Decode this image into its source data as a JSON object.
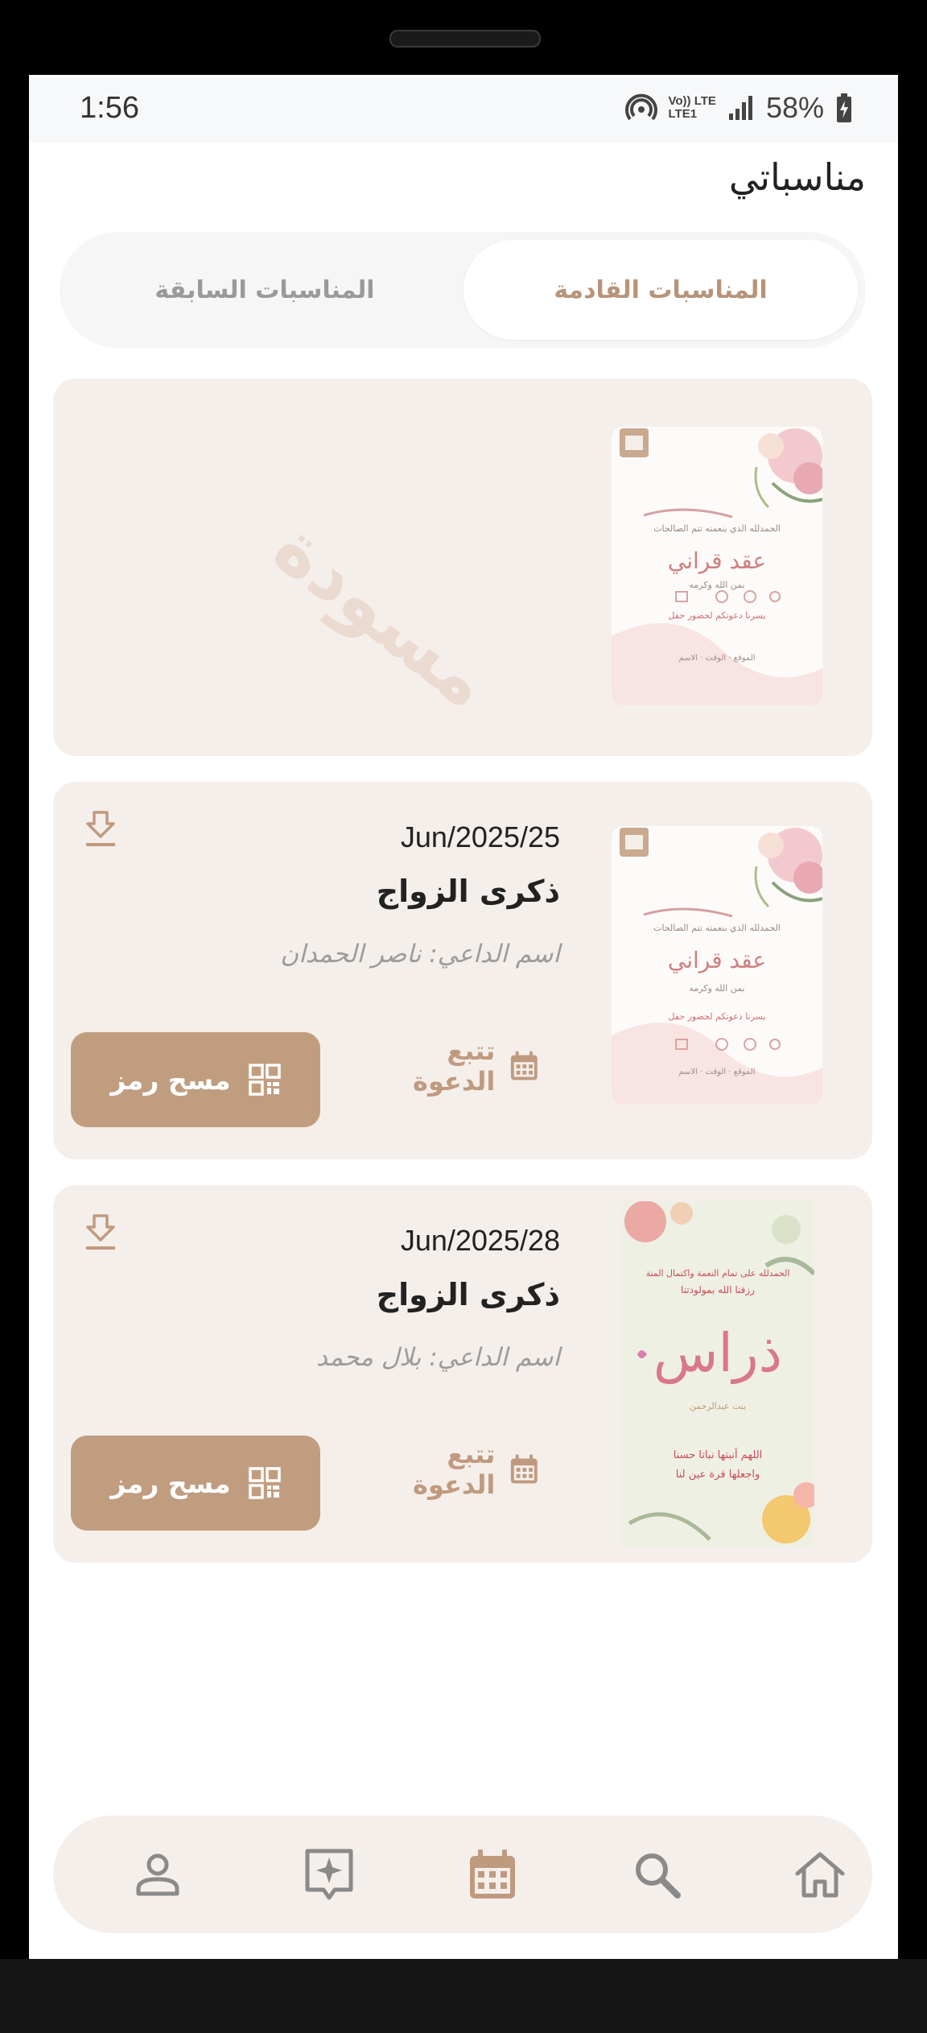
{
  "status_bar": {
    "time": "1:56",
    "network_label_top": "Vo)) LTE",
    "network_label_bottom": "LTE1",
    "battery": "58%"
  },
  "page": {
    "title": "مناسباتي"
  },
  "tabs": [
    {
      "label": "المناسبات القادمة",
      "active": true
    },
    {
      "label": "المناسبات السابقة",
      "active": false
    }
  ],
  "cards": [
    {
      "draft_label": "مسودة",
      "thumbnail": {
        "heading": "عقد قراني",
        "line1": "الحمدلله الذي بنعمته تتم الصالحات",
        "line2": "بمن الله وكرمه",
        "line3": "يسرنا دعوتكم لحضور حفل",
        "footer": "الموقع · الوقت · الاسم"
      }
    },
    {
      "date": "Jun/2025/25",
      "title": "ذكرى الزواج",
      "host": "اسم الداعي: ناصر الحمدان",
      "track_label": "تتبع الدعوة",
      "scan_label": "مسح رمز",
      "thumbnail": {
        "heading": "عقد قراني",
        "line1": "الحمدلله الذي بنعمته تتم الصالحات",
        "line2": "بمن الله وكرمه",
        "line3": "يسرنا دعوتكم لحضور حفل",
        "footer": "الموقع · الوقت · الاسم"
      }
    },
    {
      "date": "Jun/2025/28",
      "title": "ذكرى الزواج",
      "host": "اسم الداعي: بلال محمد",
      "track_label": "تتبع الدعوة",
      "scan_label": "مسح رمز",
      "thumbnail": {
        "line1": "الحمدلله على تمام النعمة واكتمال المنة",
        "line2": "رزقنا الله بمولودتنا",
        "name": "ذراس",
        "sub": "بنت عبدالرحمن",
        "line3": "اللهم أنبتها نباتا حسنا",
        "line4": "واجعلها قرة عين لنا"
      }
    }
  ],
  "bottom_nav": [
    {
      "icon": "person-icon",
      "label": "profile"
    },
    {
      "icon": "sparkle-tag-icon",
      "label": "offers"
    },
    {
      "icon": "calendar-icon",
      "label": "events",
      "active": true
    },
    {
      "icon": "search-icon",
      "label": "search"
    },
    {
      "icon": "home-icon",
      "label": "home"
    }
  ],
  "colors": {
    "accent": "#c19d80",
    "card_bg": "#f5efeb",
    "nav_inactive": "#8a8a8a"
  }
}
